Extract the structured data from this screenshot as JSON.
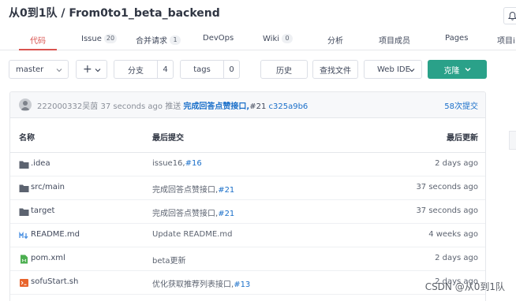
{
  "repo": {
    "title": "从0到1队 / From0to1_beta_backend"
  },
  "tabs": [
    {
      "label": "代码",
      "count": null
    },
    {
      "label": "Issue",
      "count": "20"
    },
    {
      "label": "合并请求",
      "count": "1"
    },
    {
      "label": "DevOps",
      "count": null
    },
    {
      "label": "Wiki",
      "count": "0"
    },
    {
      "label": "分析",
      "count": null
    },
    {
      "label": "项目成员",
      "count": null
    },
    {
      "label": "Pages",
      "count": null
    },
    {
      "label": "项目i",
      "count": null
    }
  ],
  "toolbar": {
    "branch": "master",
    "plus": "+",
    "branches_label": "分支",
    "branches_count": "4",
    "tags_label": "tags",
    "tags_count": "0",
    "history_label": "历史",
    "find_label": "查找文件",
    "webide_label": "Web IDE",
    "clone_label": "克隆"
  },
  "last_commit": {
    "author": "222000332吴茵",
    "time": "37 seconds ago",
    "action": "推送",
    "message": "完成回答点赞接口,",
    "ref": "#21",
    "sha": "c325a9b6",
    "commit_count": "58次提交"
  },
  "table": {
    "headers": {
      "name": "名称",
      "last_commit": "最后提交",
      "last_updated": "最后更新"
    },
    "rows": [
      {
        "icon": "folder-icon",
        "name": ".idea",
        "commit": "issue16,",
        "issue": "#16",
        "time": "2 days ago"
      },
      {
        "icon": "folder-icon",
        "name": "src/main",
        "commit": "完成回答点赞接口,",
        "issue": "#21",
        "time": "37 seconds ago"
      },
      {
        "icon": "folder-icon",
        "name": "target",
        "commit": "完成回答点赞接口,",
        "issue": "#21",
        "time": "37 seconds ago"
      },
      {
        "icon": "markdown-icon",
        "name": "README.md",
        "commit": "Update README.md",
        "issue": "",
        "time": "4 weeks ago"
      },
      {
        "icon": "xml-file-icon",
        "name": "pom.xml",
        "commit": "beta更新",
        "issue": "",
        "time": "2 days ago"
      },
      {
        "icon": "shell-file-icon",
        "name": "sofuStart.sh",
        "commit": "优化获取推荐列表接口,",
        "issue": "#13",
        "time": "2 days ago"
      }
    ]
  },
  "watermark": "CSDN @从0到1队",
  "colors": {
    "accent_red": "#d9534f",
    "link_blue": "#1a6fc9",
    "clone_green": "#2aa189",
    "folder_gray": "#5c6370",
    "markdown_blue": "#4a90e2",
    "xml_green": "#4caf50",
    "shell_orange": "#e8642c"
  }
}
